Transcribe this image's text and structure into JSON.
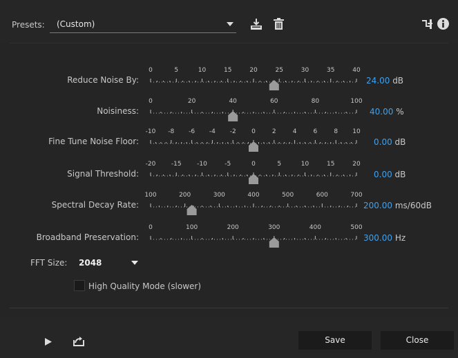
{
  "presets": {
    "label": "Presets:",
    "value": "(Custom)"
  },
  "icons": {
    "save_preset": "download-tray-icon",
    "delete_preset": "trash-icon",
    "routing": "routing-icon",
    "info": "info-icon",
    "play": "play-icon",
    "export": "export-icon"
  },
  "sliders": [
    {
      "label": "Reduce Noise By:",
      "ticks": [
        "0",
        "5",
        "10",
        "15",
        "20",
        "25",
        "30",
        "35",
        "40"
      ],
      "value": "24.00",
      "unit": "dB",
      "fraction": 0.6
    },
    {
      "label": "Noisiness:",
      "ticks": [
        "0",
        "20",
        "40",
        "60",
        "80",
        "100"
      ],
      "value": "40.00",
      "unit": "%",
      "fraction": 0.4
    },
    {
      "label": "Fine Tune Noise Floor:",
      "ticks": [
        "-10",
        "-8",
        "-6",
        "-4",
        "-2",
        "0",
        "2",
        "4",
        "6",
        "8",
        "10"
      ],
      "value": "0.00",
      "unit": "dB",
      "fraction": 0.5
    },
    {
      "label": "Signal Threshold:",
      "ticks": [
        "-20",
        "-15",
        "-10",
        "-5",
        "0",
        "5",
        "10",
        "15",
        "20"
      ],
      "value": "0.00",
      "unit": "dB",
      "fraction": 0.5
    },
    {
      "label": "Spectral Decay Rate:",
      "ticks": [
        "100",
        "200",
        "300",
        "400",
        "500",
        "600",
        "700"
      ],
      "value": "200.00",
      "unit": "ms/60dB",
      "fraction": 0.2
    },
    {
      "label": "Broadband Preservation:",
      "ticks": [
        "0",
        "100",
        "200",
        "300",
        "400",
        "500"
      ],
      "value": "300.00",
      "unit": "Hz",
      "fraction": 0.6
    }
  ],
  "fft": {
    "label": "FFT Size:",
    "value": "2048"
  },
  "high_quality": {
    "label": "High Quality Mode (slower)",
    "checked": false
  },
  "buttons": {
    "save": "Save",
    "close": "Close"
  },
  "colors": {
    "accent": "#3ea2f0",
    "thumb": "#9a9a9a"
  }
}
